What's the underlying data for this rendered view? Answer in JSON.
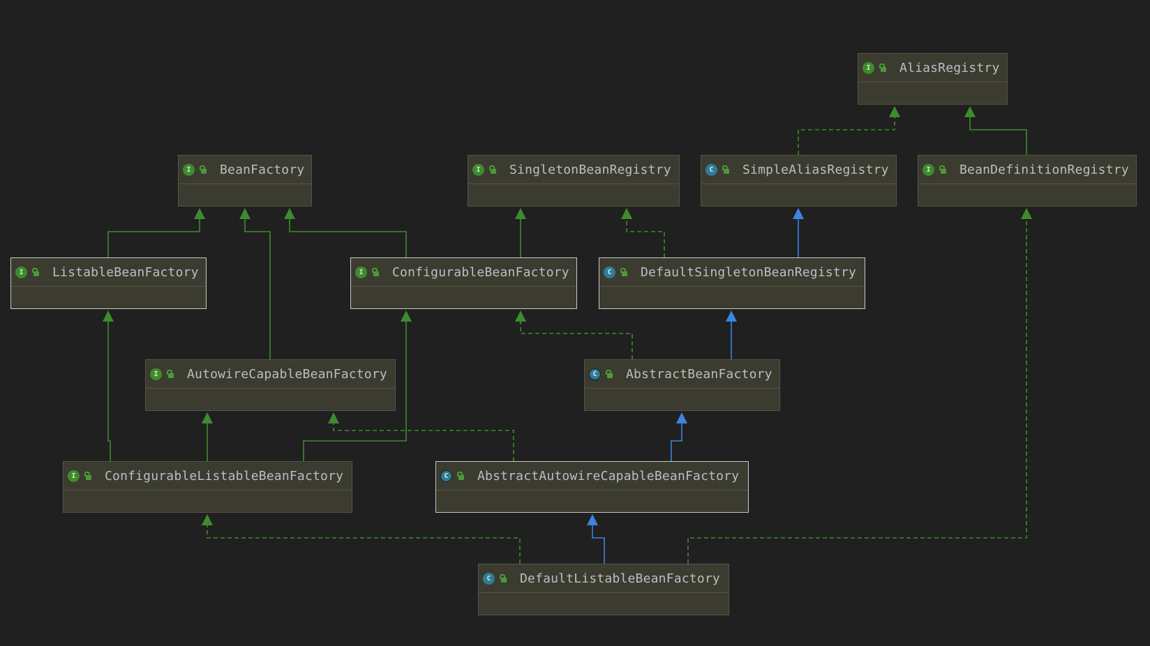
{
  "diagram": {
    "nodes": [
      {
        "id": "AliasRegistry",
        "label": "AliasRegistry",
        "kind": "interface",
        "kind_glyph": "I"
      },
      {
        "id": "BeanFactory",
        "label": "BeanFactory",
        "kind": "interface",
        "kind_glyph": "I"
      },
      {
        "id": "SingletonBeanRegistry",
        "label": "SingletonBeanRegistry",
        "kind": "interface",
        "kind_glyph": "I"
      },
      {
        "id": "SimpleAliasRegistry",
        "label": "SimpleAliasRegistry",
        "kind": "class",
        "kind_glyph": "C"
      },
      {
        "id": "BeanDefinitionRegistry",
        "label": "BeanDefinitionRegistry",
        "kind": "interface",
        "kind_glyph": "I"
      },
      {
        "id": "ListableBeanFactory",
        "label": "ListableBeanFactory",
        "kind": "interface",
        "kind_glyph": "I"
      },
      {
        "id": "ConfigurableBeanFactory",
        "label": "ConfigurableBeanFactory",
        "kind": "interface",
        "kind_glyph": "I"
      },
      {
        "id": "DefaultSingletonBeanRegistry",
        "label": "DefaultSingletonBeanRegistry",
        "kind": "class",
        "kind_glyph": "C"
      },
      {
        "id": "AutowireCapableBeanFactory",
        "label": "AutowireCapableBeanFactory",
        "kind": "interface",
        "kind_glyph": "I"
      },
      {
        "id": "AbstractBeanFactory",
        "label": "AbstractBeanFactory",
        "kind": "abstract",
        "kind_glyph": "C"
      },
      {
        "id": "ConfigurableListableBeanFactory",
        "label": "ConfigurableListableBeanFactory",
        "kind": "interface",
        "kind_glyph": "I"
      },
      {
        "id": "AbstractAutowireCapableBeanFactory",
        "label": "AbstractAutowireCapableBeanFactory",
        "kind": "abstract",
        "kind_glyph": "C"
      },
      {
        "id": "DefaultListableBeanFactory",
        "label": "DefaultListableBeanFactory",
        "kind": "class",
        "kind_glyph": "C"
      }
    ],
    "edges": [
      {
        "from": "SimpleAliasRegistry",
        "to": "AliasRegistry",
        "type": "implements"
      },
      {
        "from": "BeanDefinitionRegistry",
        "to": "AliasRegistry",
        "type": "extends-interface"
      },
      {
        "from": "ListableBeanFactory",
        "to": "BeanFactory",
        "type": "extends-interface"
      },
      {
        "from": "AutowireCapableBeanFactory",
        "to": "BeanFactory",
        "type": "extends-interface"
      },
      {
        "from": "ConfigurableBeanFactory",
        "to": "BeanFactory",
        "type": "extends-interface"
      },
      {
        "from": "ConfigurableBeanFactory",
        "to": "SingletonBeanRegistry",
        "type": "extends-interface"
      },
      {
        "from": "DefaultSingletonBeanRegistry",
        "to": "SingletonBeanRegistry",
        "type": "implements"
      },
      {
        "from": "DefaultSingletonBeanRegistry",
        "to": "SimpleAliasRegistry",
        "type": "extends-class"
      },
      {
        "from": "AbstractBeanFactory",
        "to": "ConfigurableBeanFactory",
        "type": "implements"
      },
      {
        "from": "AbstractBeanFactory",
        "to": "DefaultSingletonBeanRegistry",
        "type": "extends-class"
      },
      {
        "from": "ConfigurableListableBeanFactory",
        "to": "ListableBeanFactory",
        "type": "extends-interface"
      },
      {
        "from": "ConfigurableListableBeanFactory",
        "to": "AutowireCapableBeanFactory",
        "type": "extends-interface"
      },
      {
        "from": "ConfigurableListableBeanFactory",
        "to": "ConfigurableBeanFactory",
        "type": "extends-interface"
      },
      {
        "from": "AbstractAutowireCapableBeanFactory",
        "to": "AutowireCapableBeanFactory",
        "type": "implements"
      },
      {
        "from": "AbstractAutowireCapableBeanFactory",
        "to": "AbstractBeanFactory",
        "type": "extends-class"
      },
      {
        "from": "DefaultListableBeanFactory",
        "to": "ConfigurableListableBeanFactory",
        "type": "implements"
      },
      {
        "from": "DefaultListableBeanFactory",
        "to": "AbstractAutowireCapableBeanFactory",
        "type": "extends-class"
      },
      {
        "from": "DefaultListableBeanFactory",
        "to": "BeanDefinitionRegistry",
        "type": "implements"
      }
    ],
    "colors": {
      "background": "#202020",
      "interface_edge": "#3e8b2f",
      "class_edge": "#3d83e0",
      "node_fill": "#3c3b2f",
      "label": "#bbbfc4"
    },
    "icons": {
      "kind": "type-badge-icon",
      "visibility": "public-lock-icon"
    }
  }
}
